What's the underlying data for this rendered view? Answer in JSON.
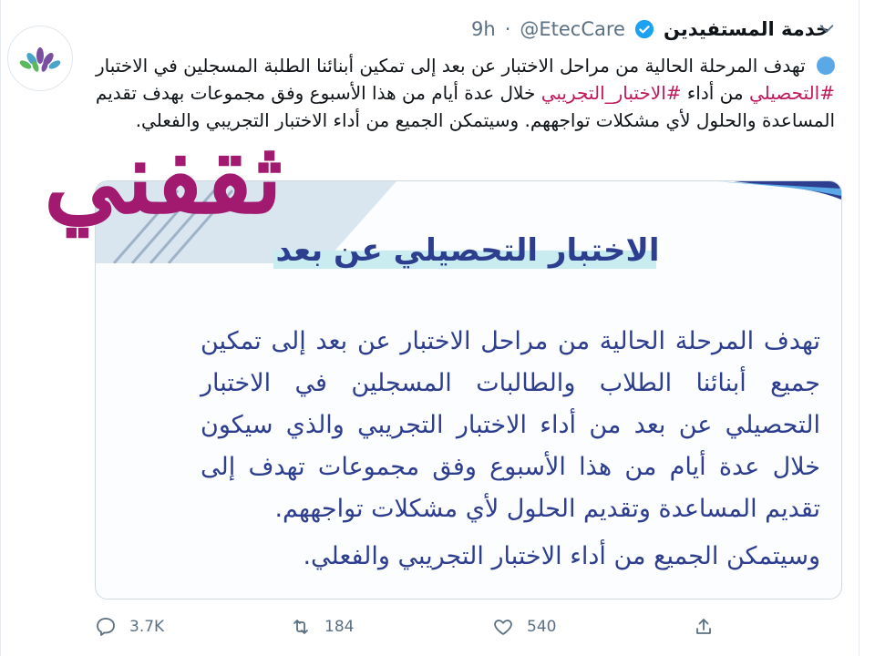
{
  "tweet": {
    "author_name": "خدمة المستفيدين",
    "handle": "@EtecCare",
    "separator": "·",
    "time": "9h",
    "text_prefix": "تهدف المرحلة الحالية من مراحل الاختبار عن بعد إلى تمكين أبنائنا الطلبة المسجلين في الاختبار",
    "hashtag_1": "#التحصيلي",
    "text_middle": "من أداء",
    "hashtag_2": "#الاختبار_التجريبي",
    "text_suffix": "خلال عدة أيام من هذا الأسبوع وفق مجموعات بهدف تقديم المساعدة والحلول لأي مشكلات تواجههم. وسيتمكن الجميع من أداء الاختبار التجريبي والفعلي."
  },
  "card": {
    "title": "الاختبار التحصيلي عن بعد",
    "paragraph_1": "تهدف المرحلة الحالية من مراحل الاختبار عن بعد إلى تمكين جميع أبنائنا الطلاب والطالبات المسجلين في الاختبار التحصيلي عن بعد من أداء الاختبار التجريبي والذي سيكون خلال عدة أيام من هذا الأسبوع وفق مجموعات تهدف إلى تقديم المساعدة وتقديم الحلول لأي مشكلات تواجههم.",
    "paragraph_2": "وسيتمكن الجميع من أداء الاختبار التجريبي والفعلي."
  },
  "watermark": "ثقفني",
  "actions": {
    "replies": "3.7K",
    "retweets": "184",
    "likes": "540"
  },
  "colors": {
    "hashtag": "#c2185b",
    "card_text": "#2d3e8f",
    "watermark": "#a11a6f",
    "verified": "#1da1f2"
  }
}
